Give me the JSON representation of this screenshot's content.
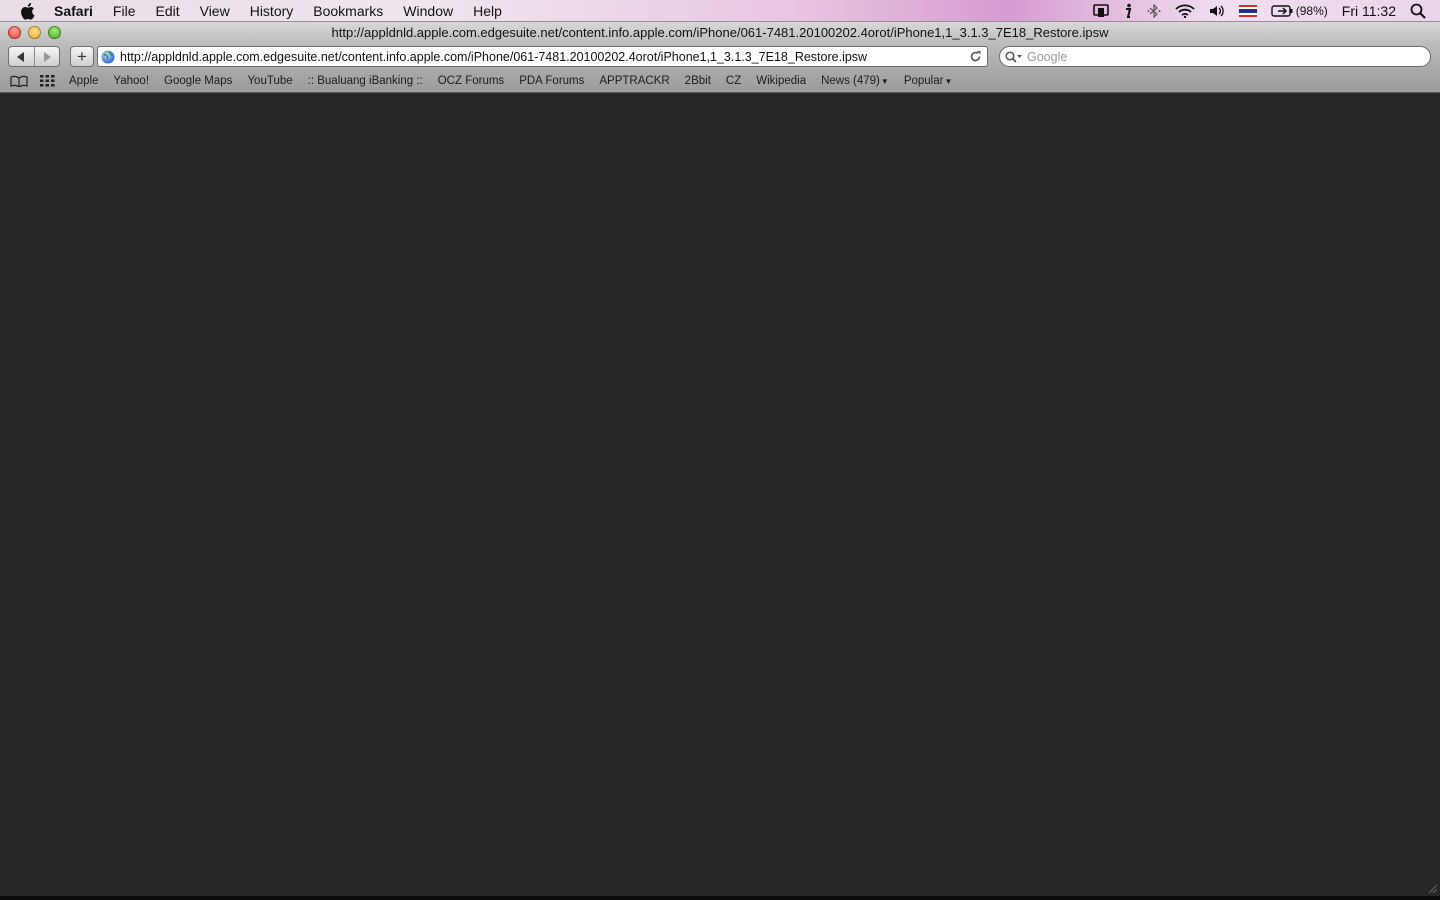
{
  "menubar": {
    "app_name": "Safari",
    "items": [
      "File",
      "Edit",
      "View",
      "History",
      "Bookmarks",
      "Window",
      "Help"
    ],
    "battery_percent": "(98%)",
    "clock": "Fri 11:32"
  },
  "window": {
    "title": "http://appldnld.apple.com.edgesuite.net/content.info.apple.com/iPhone/061-7481.20100202.4orot/iPhone1,1_3.1.3_7E18_Restore.ipsw"
  },
  "toolbar": {
    "url": "http://appldnld.apple.com.edgesuite.net/content.info.apple.com/iPhone/061-7481.20100202.4orot/iPhone1,1_3.1.3_7E18_Restore.ipsw",
    "add_label": "+",
    "search_placeholder": "Google"
  },
  "bookmarks": [
    {
      "label": "Apple"
    },
    {
      "label": "Yahoo!"
    },
    {
      "label": "Google Maps"
    },
    {
      "label": "YouTube"
    },
    {
      "label": ":: Bualuang iBanking ::"
    },
    {
      "label": "OCZ Forums"
    },
    {
      "label": "PDA Forums"
    },
    {
      "label": "APPTRACKR"
    },
    {
      "label": "2Bbit"
    },
    {
      "label": "CZ"
    },
    {
      "label": "Wikipedia"
    },
    {
      "label": "News (479)"
    },
    {
      "label": "Popular"
    }
  ],
  "colors": {
    "content_background": "#262626"
  },
  "icons": {
    "menu_extras": [
      "airplay-icon",
      "info-icon",
      "bluetooth-icon",
      "wifi-icon",
      "volume-icon",
      "thai-flag-icon",
      "battery-icon",
      "spotlight-icon"
    ]
  }
}
